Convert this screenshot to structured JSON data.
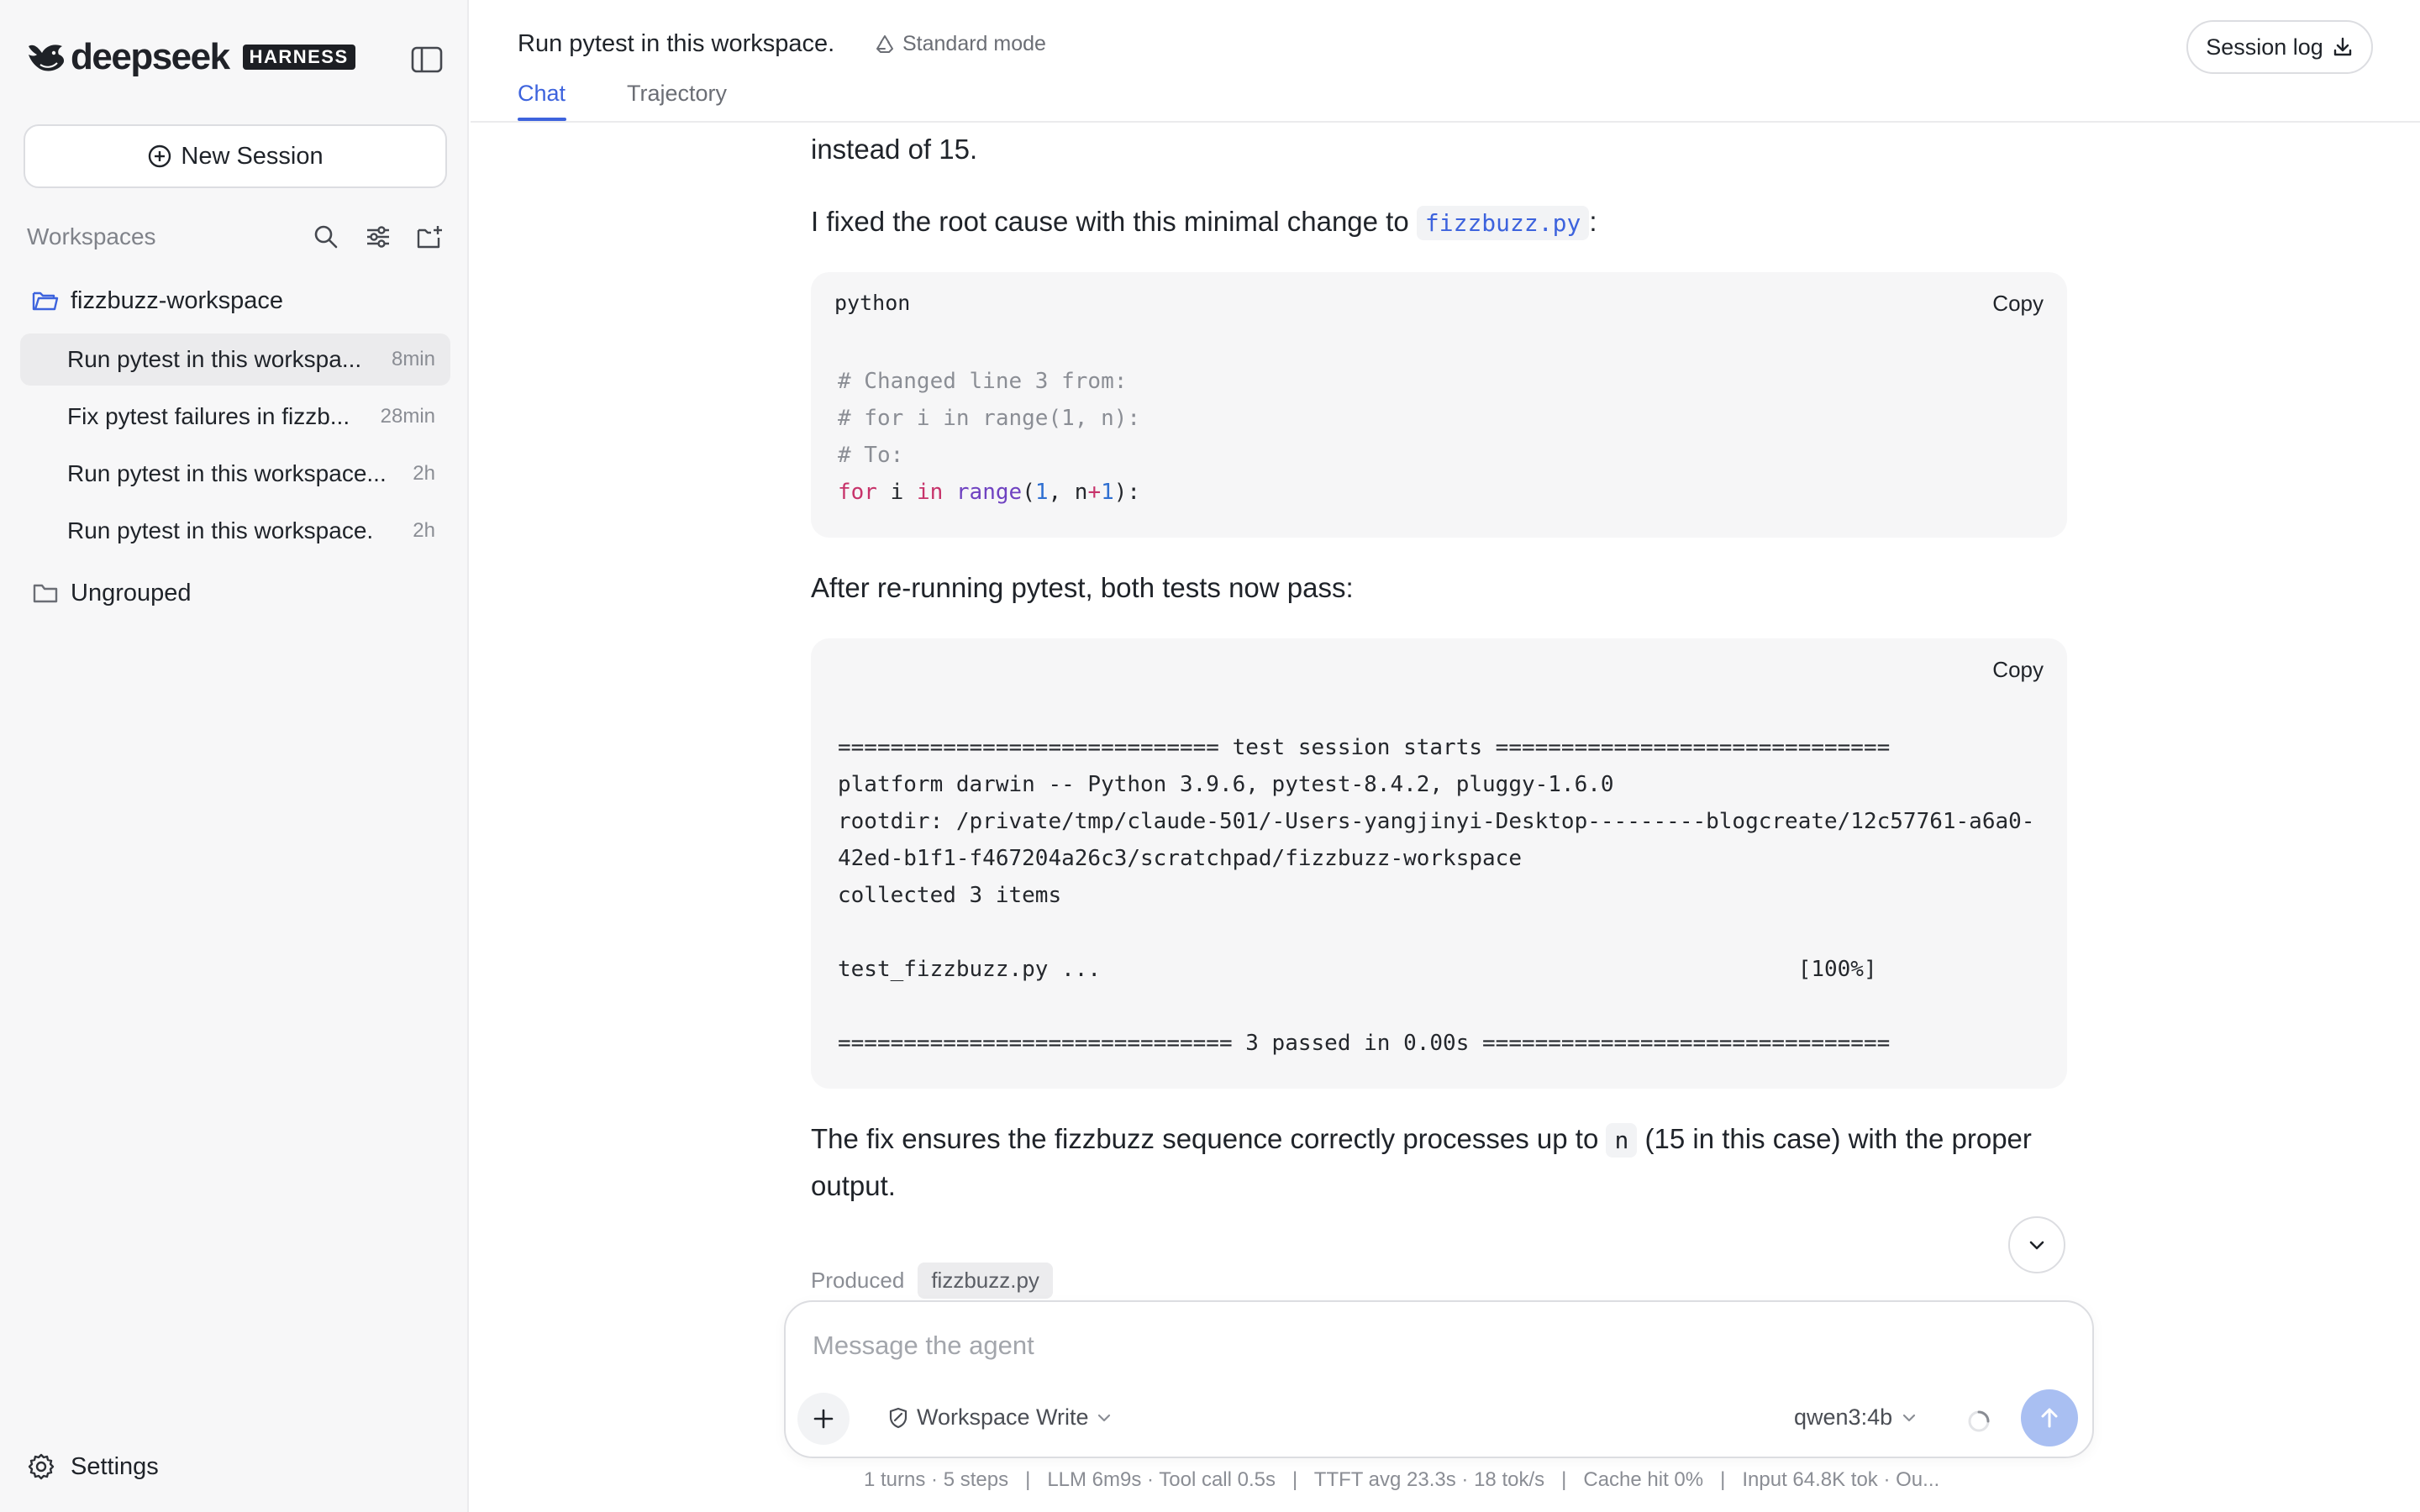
{
  "brand": {
    "name": "deepseek",
    "badge": "HARNESS"
  },
  "sidebar": {
    "new_session_label": "New Session",
    "workspaces_title": "Workspaces",
    "groups": [
      {
        "name": "fizzbuzz-workspace"
      },
      {
        "name": "Ungrouped"
      }
    ],
    "sessions": [
      {
        "title": "Run pytest in this workspace.",
        "display": "Run pytest in this workspa...",
        "time": "8min",
        "active": true
      },
      {
        "title": "Fix pytest failures in fizzbuzz",
        "display": "Fix pytest failures in fizzb...",
        "time": "28min",
        "active": false
      },
      {
        "title": "Run pytest in this workspace.",
        "display": "Run pytest in this workspace...",
        "time": "2h",
        "active": false
      },
      {
        "title": "Run pytest in this workspace.",
        "display": "Run pytest in this workspace.",
        "time": "2h",
        "active": false
      }
    ],
    "settings_label": "Settings"
  },
  "header": {
    "title": "Run pytest in this workspace.",
    "mode": "Standard mode",
    "tabs": [
      {
        "label": "Chat",
        "active": true
      },
      {
        "label": "Trajectory",
        "active": false
      }
    ],
    "session_log_label": "Session log"
  },
  "chat": {
    "text_top": "instead of 15.",
    "fix_intro_prefix": "I fixed the root cause with this minimal change to",
    "fix_intro_file": "fizzbuzz.py",
    "fix_intro_suffix": ":",
    "code1": {
      "lang": "python",
      "copy_label": "Copy",
      "comment1": "# Changed line 3 from:",
      "comment2": "# for i in range(1, n):",
      "comment3": "# To:",
      "kw_for": "for",
      "var_i": " i ",
      "kw_in": "in",
      "fn_range": "range",
      "paren_open": "(",
      "num_1": "1",
      "comma_n": ", n",
      "op_plus": "+",
      "num_1b": "1",
      "tail": "):"
    },
    "after_text": "After re-running pytest, both tests now pass:",
    "code2": {
      "copy_label": "Copy",
      "lines": [
        "============================= test session starts ==============================",
        "platform darwin -- Python 3.9.6, pytest-8.4.2, pluggy-1.6.0",
        "rootdir: /private/tmp/claude-501/-Users-yangjinyi-Desktop---------blogcreate/12c57761-a6a0-",
        "42ed-b1f1-f467204a26c3/scratchpad/fizzbuzz-workspace",
        "collected 3 items",
        "",
        "test_fizzbuzz.py ...                                                     [100%]",
        "",
        "============================== 3 passed in 0.00s ==============================="
      ]
    },
    "final_prefix": "The fix ensures the fizzbuzz sequence correctly processes up to",
    "final_code": "n",
    "final_suffix": "(15 in this case) with the proper",
    "final_line2": "output.",
    "produced_label": "Produced",
    "produced_file": "fizzbuzz.py"
  },
  "composer": {
    "placeholder": "Message the agent",
    "permission": "Workspace Write",
    "model": "qwen3:4b"
  },
  "stats": "1 turns · 5 steps   |   LLM 6m9s · Tool call 0.5s   |   TTFT avg 23.3s · 18 tok/s   |   Cache hit 0%   |   Input 64.8K tok · Ou...",
  "colors": {
    "accent": "#3d63dd",
    "send_disabled": "#a9bff2",
    "sidebar_bg": "#f7f7f8"
  }
}
